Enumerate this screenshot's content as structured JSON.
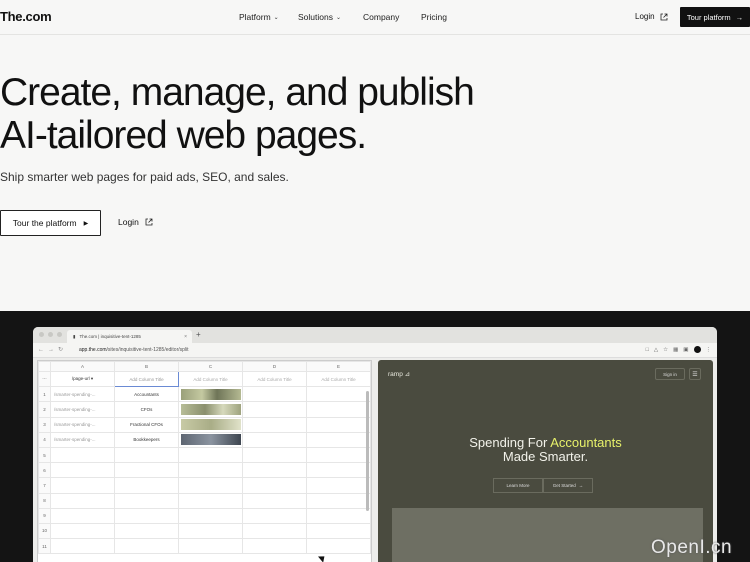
{
  "nav": {
    "logo": "The.com",
    "links": [
      {
        "label": "Platform",
        "has_dropdown": true
      },
      {
        "label": "Solutions",
        "has_dropdown": true
      },
      {
        "label": "Company",
        "has_dropdown": false
      },
      {
        "label": "Pricing",
        "has_dropdown": false
      }
    ],
    "login": "Login",
    "cta": "Tour platform"
  },
  "hero": {
    "title_line1": "Create, manage, and publish",
    "title_line2": "AI-tailored web pages.",
    "subtitle": "Ship smarter web pages for paid ads, SEO, and sales.",
    "tour_button": "Tour the platform",
    "login_link": "Login"
  },
  "browser": {
    "tab_title": "The.com | inquisitive-tent-1285",
    "url_domain": "app.the.com",
    "url_path": "/sites/inquisitive-tent-1285/editor/split"
  },
  "sheet": {
    "column_letters": [
      "A",
      "B",
      "C",
      "D",
      "E"
    ],
    "header_row": [
      "/page-url",
      "Add Column Title",
      "Add Column Title",
      "Add Column Title",
      "Add Column Title"
    ],
    "rows": [
      {
        "num": "1",
        "url": "/smarter-spending-...",
        "title": "Accountants",
        "has_image": true
      },
      {
        "num": "2",
        "url": "/smarter-spending-...",
        "title": "CFOs",
        "has_image": true
      },
      {
        "num": "3",
        "url": "/smarter-spending-...",
        "title": "Fractional CFOs",
        "has_image": true
      },
      {
        "num": "4",
        "url": "/smarter-spending-...",
        "title": "Bookkeepers",
        "has_image": true
      },
      {
        "num": "5",
        "url": "",
        "title": "",
        "has_image": false
      },
      {
        "num": "6",
        "url": "",
        "title": "",
        "has_image": false
      },
      {
        "num": "7",
        "url": "",
        "title": "",
        "has_image": false
      },
      {
        "num": "8",
        "url": "",
        "title": "",
        "has_image": false
      },
      {
        "num": "9",
        "url": "",
        "title": "",
        "has_image": false
      },
      {
        "num": "10",
        "url": "",
        "title": "",
        "has_image": false
      },
      {
        "num": "11",
        "url": "",
        "title": "",
        "has_image": false
      }
    ]
  },
  "preview": {
    "brand": "ramp",
    "sign_in": "Sign in",
    "headline_prefix": "Spending For ",
    "headline_accent": "Accountants",
    "headline_line2": "Made Smarter.",
    "learn_more": "Learn More",
    "get_started": "Get Started",
    "accent_color": "#e7f16a"
  },
  "watermark": "OpenI.cn"
}
